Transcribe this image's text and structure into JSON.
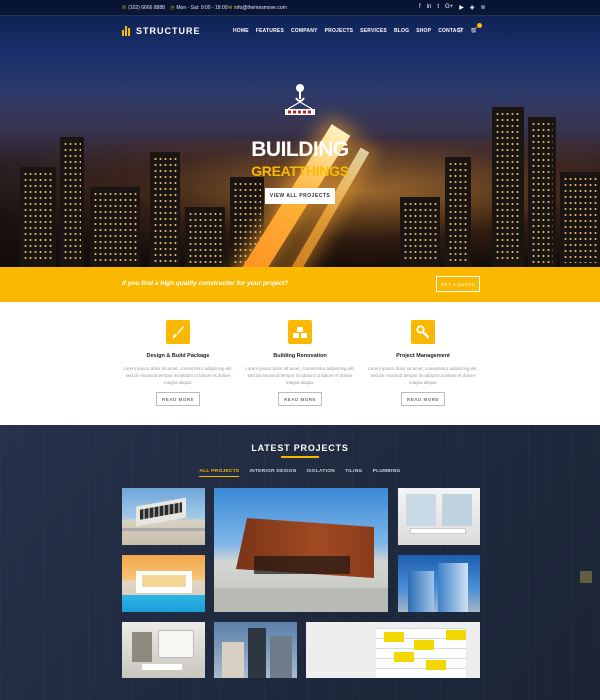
{
  "topbar": {
    "phone": "(102) 6666 8888",
    "hours": "Mon - Sat: 9:00 - 18:00",
    "email": "info@themesmove.com"
  },
  "brand": {
    "name": "STRUCTURE",
    "accent": "#fbb800"
  },
  "nav": {
    "items": [
      "HOME",
      "FEATURES",
      "COMPANY",
      "PROJECTS",
      "SERVICES",
      "BLOG",
      "SHOP",
      "CONTACT"
    ]
  },
  "hero": {
    "title": "BUILDING",
    "subtitle": "GREATTHINGS",
    "button": "VIEW ALL PROJECTS"
  },
  "cta": {
    "text": "If you find a high quality constructor for your project?",
    "button": "GET A QUOTE"
  },
  "services": [
    {
      "title": "Design & Build Package",
      "desc": "Lorem ipsum dolor sit amet, consectetur adipiscing elit, sed do eiusmod tempor incididunt ut labore et dolore magna aliqua.",
      "button": "READ MORE",
      "icon": "paintbrush-icon"
    },
    {
      "title": "Building Renovation",
      "desc": "Lorem ipsum dolor sit amet, consectetur adipiscing elit, sed do eiusmod tempor incididunt ut labore et dolore magna aliqua.",
      "button": "READ MORE",
      "icon": "bricks-icon"
    },
    {
      "title": "Project Management",
      "desc": "Lorem ipsum dolor sit amet, consectetur adipiscing elit, sed do eiusmod tempor incididunt ut labore et dolore magna aliqua.",
      "button": "READ MORE",
      "icon": "wrench-icon"
    }
  ],
  "projects": {
    "title": "LATEST PROJECTS",
    "filters": [
      "ALL PROJECTS",
      "INTERIOR DESIGN",
      "ISOLATION",
      "TILING",
      "PLUMBING"
    ],
    "active_filter": "ALL PROJECTS"
  }
}
